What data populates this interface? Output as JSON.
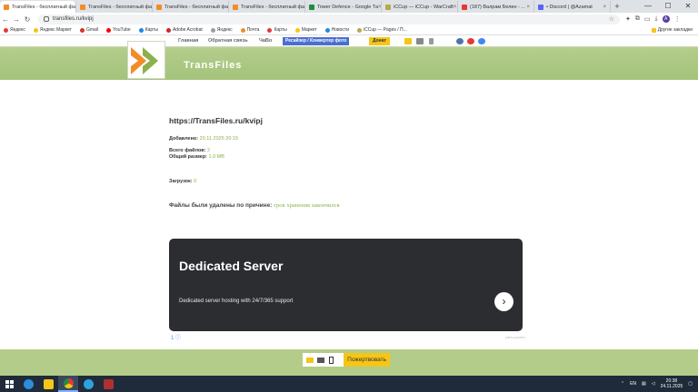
{
  "browser": {
    "tabs": [
      {
        "label": "TransFiles - бесплатный фа",
        "color": "#f28c28",
        "active": true
      },
      {
        "label": "TransFiles - бесплатный фа",
        "color": "#f28c28",
        "active": false
      },
      {
        "label": "TransFiles - бесплатный фа",
        "color": "#f28c28",
        "active": false
      },
      {
        "label": "TransFiles - бесплатный фа",
        "color": "#f28c28",
        "active": false
      },
      {
        "label": "Tower Defence - Google Та",
        "color": "#1e8e3e",
        "active": false
      },
      {
        "label": "iCCup — iCCup - WarCraft",
        "color": "#b7a84a",
        "active": false
      },
      {
        "label": "(187) Валрам Белин - ...",
        "color": "#e53935",
        "active": false
      },
      {
        "label": "• Discord | @Azamat",
        "color": "#5865f2",
        "active": false
      }
    ],
    "url": "transfiles.ru/kvipj",
    "profile_letter": "A",
    "bookmarks": [
      {
        "label": "Яндекс",
        "color": "#e53935"
      },
      {
        "label": "Яндекс Маркет",
        "color": "#f5c518"
      },
      {
        "label": "Gmail",
        "color": "#d93025"
      },
      {
        "label": "YouTube",
        "color": "#ff0000"
      },
      {
        "label": "Карты",
        "color": "#1e88e5"
      },
      {
        "label": "Adobe Acrobat",
        "color": "#c62828"
      },
      {
        "label": "Яндекс",
        "color": "#9e9e9e"
      },
      {
        "label": "Почта",
        "color": "#f28c28"
      },
      {
        "label": "Карты",
        "color": "#e53935"
      },
      {
        "label": "Маркет",
        "color": "#f5c518"
      },
      {
        "label": "Новости",
        "color": "#1e88e5"
      },
      {
        "label": "iCCup — Pages / П...",
        "color": "#b7a84a"
      }
    ],
    "bookmarks_other": "Другие закладки"
  },
  "site": {
    "nav": {
      "home": "Главная",
      "feedback": "Обратная связь",
      "faq": "ЧаВо",
      "resizer": "Ресайзер / Конвертер фото",
      "donate": "Донат"
    },
    "brand": "TransFiles",
    "file_url": "https://TransFiles.ru/kvipj",
    "added_label": "Добавлено:",
    "added_value": "20.11.2025 20:15",
    "files_label": "Всего файлов:",
    "files_value": "2",
    "size_label": "Общий размер:",
    "size_value": "1.0 MB",
    "downloads_label": "Загрузок:",
    "downloads_value": "0",
    "deleted_label": "Файлы были удалены по причине:",
    "deleted_reason": "срок хранения закончился"
  },
  "ad": {
    "headline": "Dedicated Server",
    "subtitle": "Dedicated server hosting with 24/7/365 support",
    "arrow": "›",
    "info": "1 ⓘ",
    "source": "yabs.yandex"
  },
  "footer": {
    "donate_button": "Пожертвовать"
  },
  "taskbar": {
    "lang": "EN",
    "time": "20:38",
    "date": "24.11.2025"
  }
}
